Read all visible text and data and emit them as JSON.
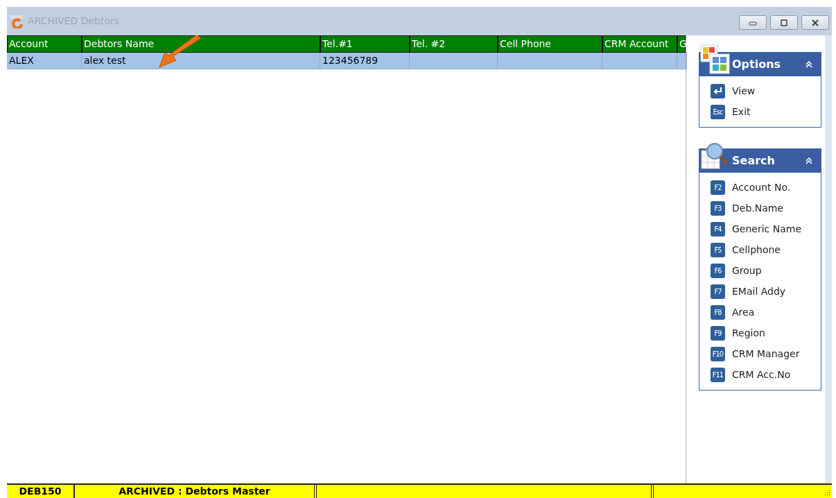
{
  "window": {
    "title": "ARCHIVED Debtors"
  },
  "table": {
    "columns": [
      "Account",
      "Debtors Name",
      "Tel.#1",
      "Tel. #2",
      "Cell Phone",
      "CRM Account",
      "G"
    ],
    "rows": [
      {
        "selected": true,
        "cells": [
          "ALEX",
          "alex test",
          "123456789",
          "",
          "",
          "",
          ""
        ]
      }
    ]
  },
  "options": {
    "title": "Options",
    "items": [
      {
        "kind": "enter",
        "label": "View"
      },
      {
        "kind": "key",
        "key": "Esc",
        "label": "Exit"
      }
    ]
  },
  "search": {
    "title": "Search",
    "items": [
      {
        "key": "F2",
        "label": "Account No."
      },
      {
        "key": "F3",
        "label": "Deb.Name"
      },
      {
        "key": "F4",
        "label": "Generic Name"
      },
      {
        "key": "F5",
        "label": "Cellphone"
      },
      {
        "key": "F6",
        "label": "Group"
      },
      {
        "key": "F7",
        "label": "EMail Addy"
      },
      {
        "key": "F8",
        "label": "Area"
      },
      {
        "key": "F9",
        "label": "Region"
      },
      {
        "key": "F10",
        "label": "CRM Manager"
      },
      {
        "key": "F11",
        "label": "CRM Acc.No"
      }
    ]
  },
  "status_bar": [
    "DEB150",
    "ARCHIVED : Debtors Master"
  ]
}
